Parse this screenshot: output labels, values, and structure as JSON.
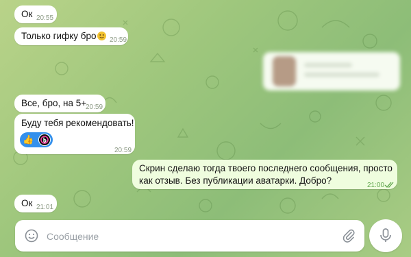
{
  "messages": [
    {
      "text": "Ок",
      "time": "20:55"
    },
    {
      "text": "Только гифку бро",
      "time": "20:59"
    },
    {
      "text": "Все, бро, на 5+",
      "time": "20:59"
    },
    {
      "text": "Буду тебя рекомендовать!",
      "time": "20:59",
      "reaction_icon": "thumbs-up-icon"
    },
    {
      "text_line1": "Скрин сделаю тогда твоего последнего сообщения, просто",
      "text_line2": "как отзыв. Без публикации аватарки. Добро?",
      "time": "21:00",
      "status": "read"
    },
    {
      "text": "Ок",
      "time": "21:01"
    }
  ],
  "reaction": {
    "emoji": "👍"
  },
  "composer": {
    "placeholder": "Сообщение"
  },
  "colors": {
    "incoming_bubble": "#ffffff",
    "outgoing_bubble": "#effdde",
    "reaction_bg": "#3390ec",
    "read_check": "#5ea54b"
  }
}
